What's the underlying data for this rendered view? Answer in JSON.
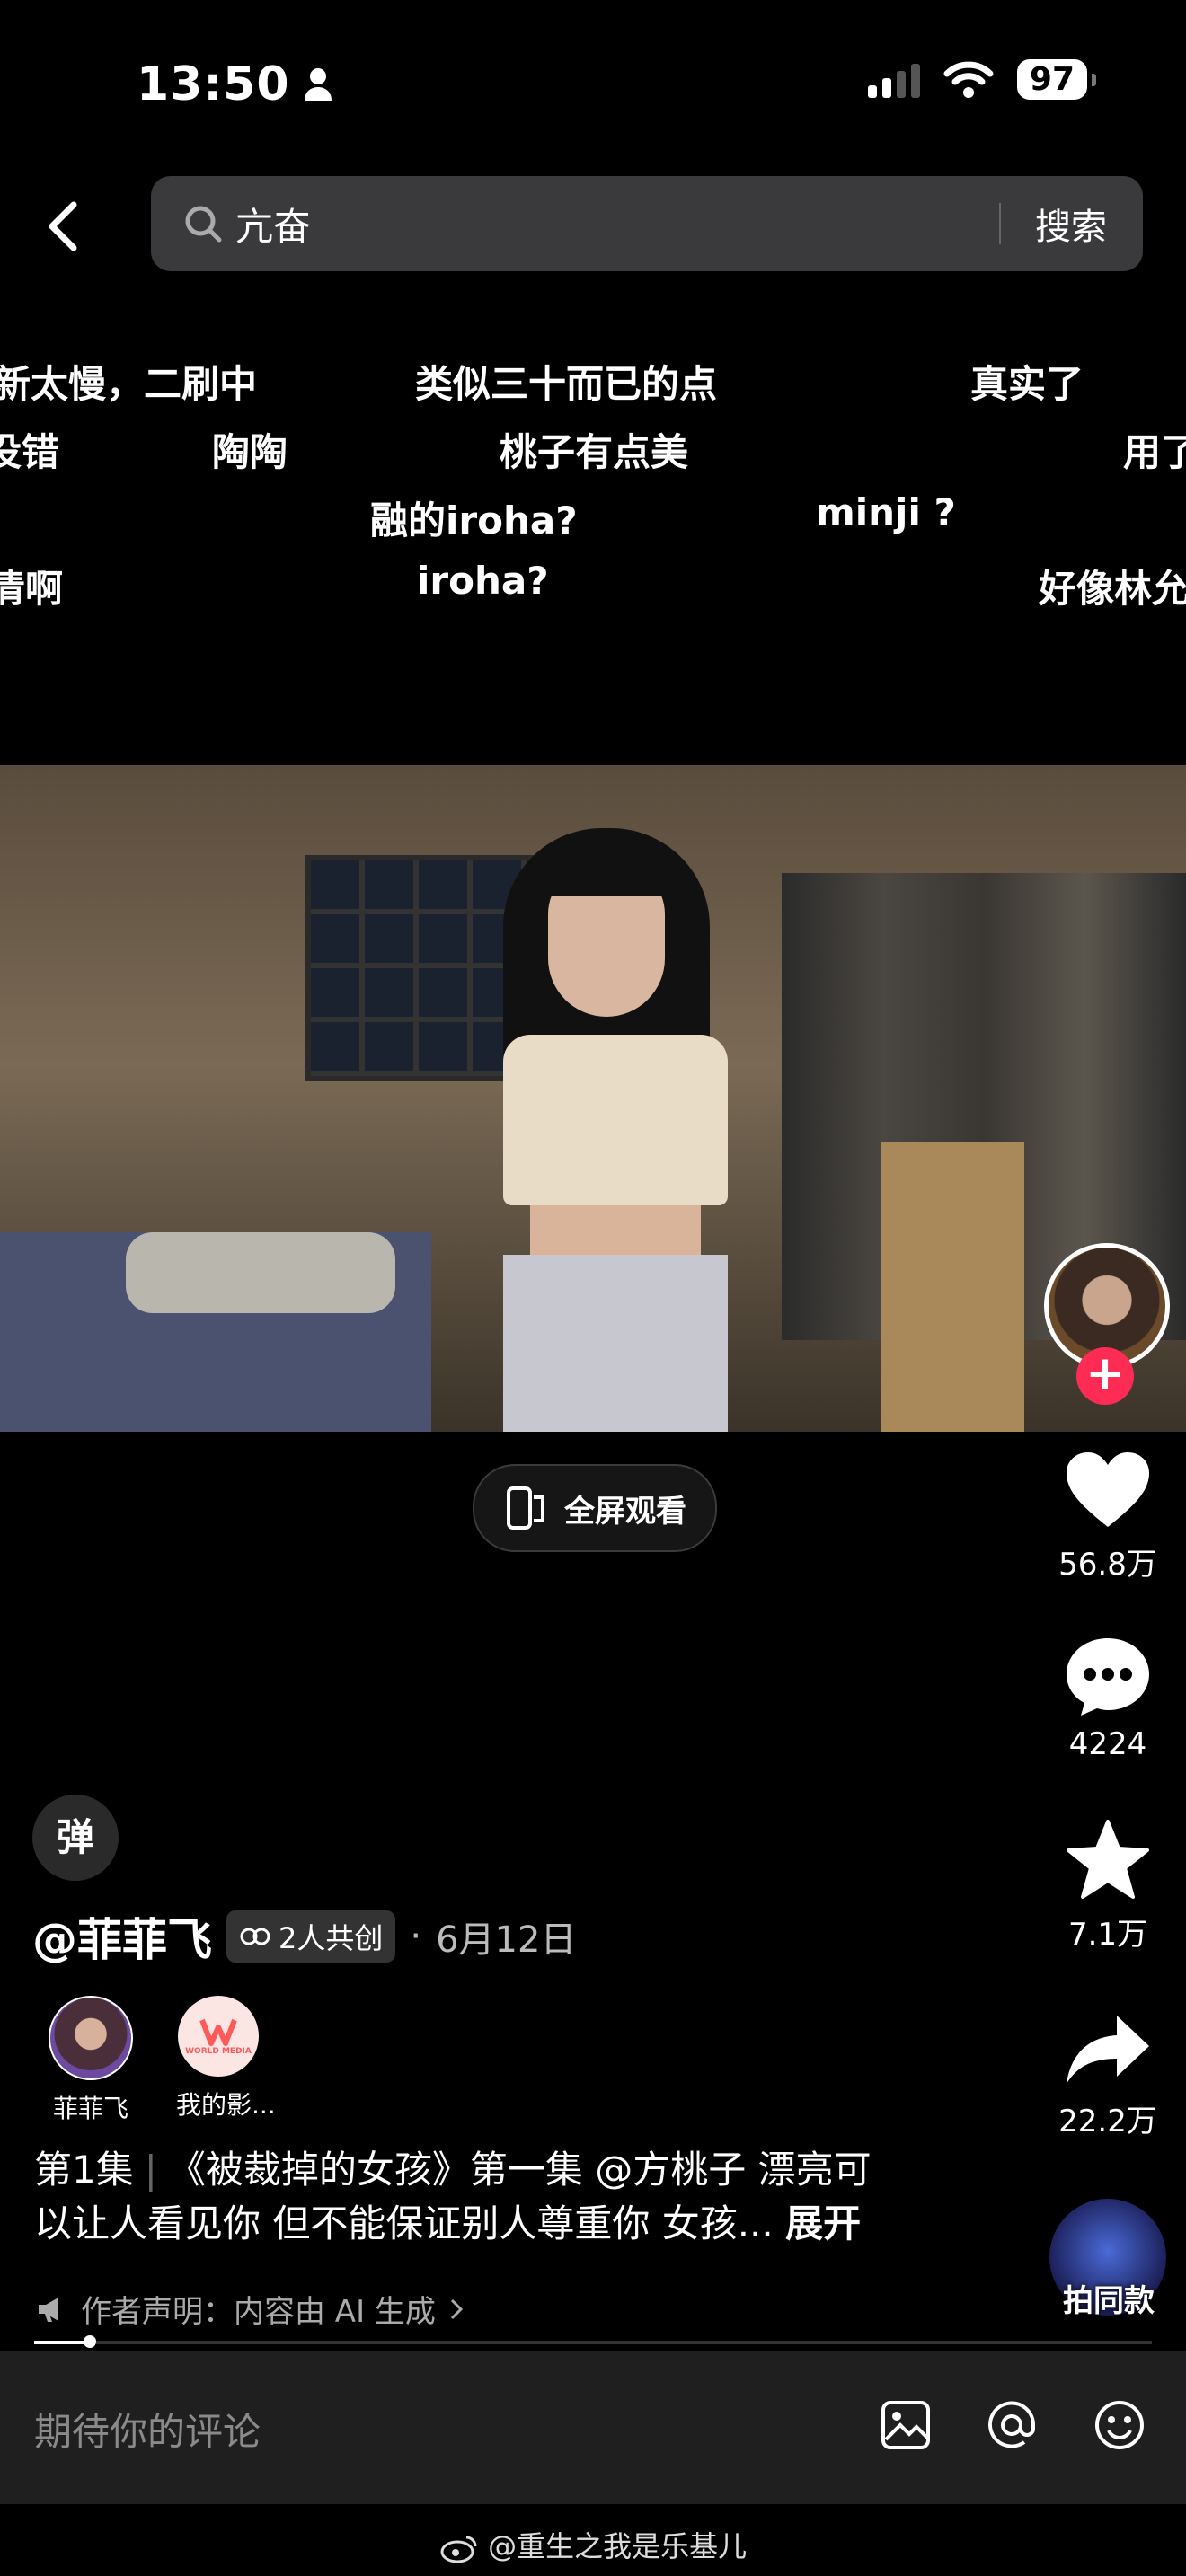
{
  "status": {
    "time": "13:50",
    "battery": "97"
  },
  "search": {
    "query": "亢奋",
    "button": "搜索"
  },
  "danmaku": [
    "新太慢，二刷中",
    "类似三十而已的点",
    "真实了",
    "没错",
    "陶陶",
    "桃子有点美",
    "用了",
    "融的iroha?",
    "minji ?",
    "清啊",
    "iroha?",
    "好像林允"
  ],
  "video": {
    "fullscreen_label": "全屏观看"
  },
  "actions": {
    "likes": "56.8万",
    "comments": "4224",
    "favorites": "7.1万",
    "shares": "22.2万",
    "remake": "拍同款"
  },
  "danmu_toggle": "弹",
  "author": {
    "name": "@菲菲飞",
    "cocreate": "2人共创",
    "dot": "·",
    "date": "6月12日"
  },
  "cocreators": [
    {
      "name": "菲菲飞"
    },
    {
      "name": "我的影...",
      "logo_text": "WORLD MEDIA"
    }
  ],
  "description": {
    "episode": "第1集",
    "text_line1": "《被裁掉的女孩》第一集 @方桃子 漂亮可",
    "text_line2": "以让人看见你 但不能保证别人尊重你 女孩...",
    "more": "展开"
  },
  "statement": "作者声明：内容由 AI 生成",
  "progress": 0.05,
  "comment": {
    "placeholder": "期待你的评论"
  },
  "watermark": "@重生之我是乐基儿",
  "colors": {
    "accent": "#fe2c55",
    "background": "#000000"
  }
}
